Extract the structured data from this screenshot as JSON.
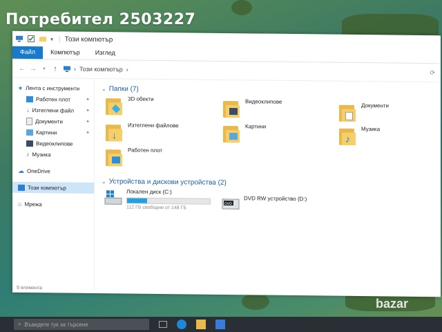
{
  "overlay": {
    "title": "Потребител 2503227"
  },
  "titlebar": {
    "title": "Този компютър"
  },
  "ribbon": {
    "tabs": [
      "Файл",
      "Компютър",
      "Изглед"
    ]
  },
  "address": {
    "path": "Този компютър",
    "separator": "›"
  },
  "navpane": {
    "quick_access": "Лента с инструменти",
    "quick_items": [
      {
        "label": "Работен плот",
        "pinned": true
      },
      {
        "label": "Изтеглени файл",
        "pinned": true
      },
      {
        "label": "Документи",
        "pinned": true
      },
      {
        "label": "Картини",
        "pinned": true
      },
      {
        "label": "Видеоклипове",
        "pinned": false
      },
      {
        "label": "Музика",
        "pinned": false
      }
    ],
    "onedrive": "OneDrive",
    "this_pc": "Този компютър",
    "network": "Мрежа"
  },
  "folders_section": {
    "header": "Папки (7)"
  },
  "folders": [
    {
      "label": "3D обекти",
      "icon": "cube-3d-icon"
    },
    {
      "label": "Видеоклипове",
      "icon": "film-icon"
    },
    {
      "label": "Документи",
      "icon": "document-icon"
    },
    {
      "label": "Изтеглени файлове",
      "icon": "download-arrow-icon"
    },
    {
      "label": "Картини",
      "icon": "picture-icon"
    },
    {
      "label": "Музика",
      "icon": "music-note-icon"
    },
    {
      "label": "Работен плот",
      "icon": "desktop-icon"
    }
  ],
  "devices_section": {
    "header": "Устройства и дискови устройства (2)"
  },
  "drives": {
    "local": {
      "label": "Локален диск (C:)",
      "free_text": "112 ГБ свободни от 148 ГБ",
      "used_fraction": 0.24
    },
    "dvd": {
      "label": "DVD RW устройство (D:)",
      "badge": "DVD"
    }
  },
  "statusbar": {
    "text": "9 елемента"
  },
  "taskbar": {
    "search_placeholder": "Въведете тук за търсене"
  },
  "watermark": {
    "text": "bazar"
  },
  "colors": {
    "accent": "#1979ca",
    "header_blue": "#1a5da8",
    "selected": "#cce5f9",
    "folder": "#f5cf6a",
    "progress": "#26a0da"
  }
}
